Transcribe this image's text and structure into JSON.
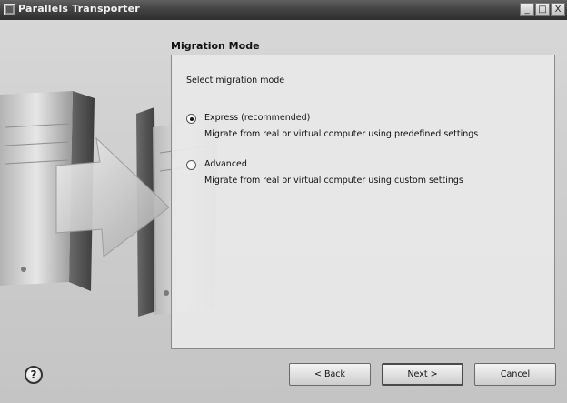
{
  "window": {
    "title": "Parallels Transporter",
    "controls": [
      "_",
      "□",
      "X"
    ]
  },
  "page": {
    "section_title": "Migration Mode",
    "prompt": "Select migration mode",
    "options": [
      {
        "label": "Express (recommended)",
        "description": "Migrate from real or virtual computer using predefined settings",
        "selected": true
      },
      {
        "label": "Advanced",
        "description": "Migrate from real or virtual computer using custom settings",
        "selected": false
      }
    ]
  },
  "footer": {
    "help": "?",
    "back": "< Back",
    "next": "Next >",
    "cancel": "Cancel"
  }
}
